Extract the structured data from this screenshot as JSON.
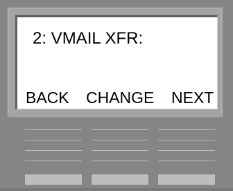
{
  "display": {
    "line1": "2: VMAIL XFR:"
  },
  "softkeys": {
    "back_label": "BACK",
    "change_label": "CHANGE",
    "next_label": "NEXT"
  },
  "colors": {
    "housing": "#858585",
    "bezel": "#a3a3a3",
    "lcd_background": "#ffffff",
    "text": "#000000",
    "keycap": "#bdbdbd"
  }
}
